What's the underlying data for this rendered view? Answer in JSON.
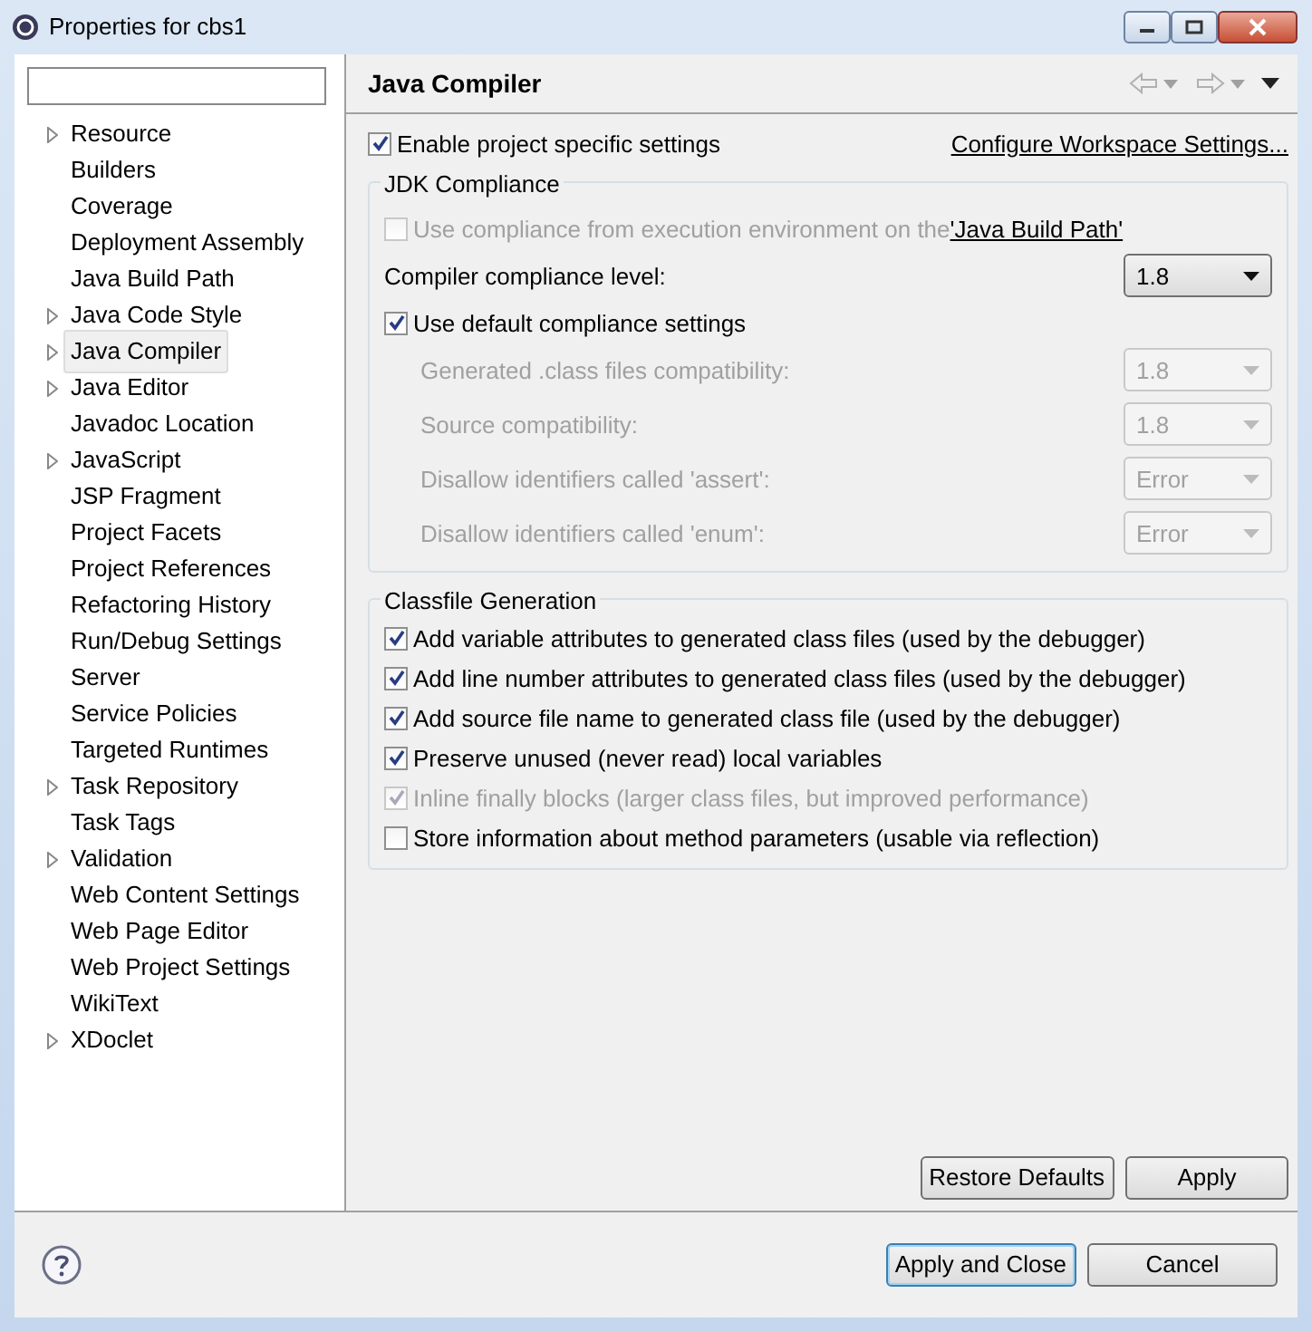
{
  "window": {
    "title": "Properties for cbs1"
  },
  "sidebar": {
    "items": [
      {
        "label": "Resource",
        "expandable": true,
        "selected": false
      },
      {
        "label": "Builders",
        "expandable": false,
        "selected": false
      },
      {
        "label": "Coverage",
        "expandable": false,
        "selected": false
      },
      {
        "label": "Deployment Assembly",
        "expandable": false,
        "selected": false
      },
      {
        "label": "Java Build Path",
        "expandable": false,
        "selected": false
      },
      {
        "label": "Java Code Style",
        "expandable": true,
        "selected": false
      },
      {
        "label": "Java Compiler",
        "expandable": true,
        "selected": true
      },
      {
        "label": "Java Editor",
        "expandable": true,
        "selected": false
      },
      {
        "label": "Javadoc Location",
        "expandable": false,
        "selected": false
      },
      {
        "label": "JavaScript",
        "expandable": true,
        "selected": false
      },
      {
        "label": "JSP Fragment",
        "expandable": false,
        "selected": false
      },
      {
        "label": "Project Facets",
        "expandable": false,
        "selected": false
      },
      {
        "label": "Project References",
        "expandable": false,
        "selected": false
      },
      {
        "label": "Refactoring History",
        "expandable": false,
        "selected": false
      },
      {
        "label": "Run/Debug Settings",
        "expandable": false,
        "selected": false
      },
      {
        "label": "Server",
        "expandable": false,
        "selected": false
      },
      {
        "label": "Service Policies",
        "expandable": false,
        "selected": false
      },
      {
        "label": "Targeted Runtimes",
        "expandable": false,
        "selected": false
      },
      {
        "label": "Task Repository",
        "expandable": true,
        "selected": false
      },
      {
        "label": "Task Tags",
        "expandable": false,
        "selected": false
      },
      {
        "label": "Validation",
        "expandable": true,
        "selected": false
      },
      {
        "label": "Web Content Settings",
        "expandable": false,
        "selected": false
      },
      {
        "label": "Web Page Editor",
        "expandable": false,
        "selected": false
      },
      {
        "label": "Web Project Settings",
        "expandable": false,
        "selected": false
      },
      {
        "label": "WikiText",
        "expandable": false,
        "selected": false
      },
      {
        "label": "XDoclet",
        "expandable": true,
        "selected": false
      }
    ]
  },
  "page": {
    "title": "Java Compiler"
  },
  "project_settings": {
    "label": "Enable project specific settings",
    "checked": true,
    "link": "Configure Workspace Settings..."
  },
  "jdk_compliance": {
    "title": "JDK Compliance",
    "use_environment": {
      "label": "Use compliance from execution environment on the ",
      "link": "'Java Build Path'",
      "checked": false,
      "disabled": true
    },
    "compliance_level": {
      "label": "Compiler compliance level:",
      "value": "1.8",
      "disabled": false
    },
    "use_default": {
      "label": "Use default compliance settings",
      "checked": true
    },
    "settings": [
      {
        "label": "Generated .class files compatibility:",
        "value": "1.8",
        "disabled": true
      },
      {
        "label": "Source compatibility:",
        "value": "1.8",
        "disabled": true
      },
      {
        "label": "Disallow identifiers called 'assert':",
        "value": "Error",
        "disabled": true
      },
      {
        "label": "Disallow identifiers called 'enum':",
        "value": "Error",
        "disabled": true
      }
    ]
  },
  "classfile_generation": {
    "title": "Classfile Generation",
    "options": [
      {
        "label": "Add variable attributes to generated class files (used by the debugger)",
        "checked": true,
        "disabled": false
      },
      {
        "label": "Add line number attributes to generated class files (used by the debugger)",
        "checked": true,
        "disabled": false
      },
      {
        "label": "Add source file name to generated class file (used by the debugger)",
        "checked": true,
        "disabled": false
      },
      {
        "label": "Preserve unused (never read) local variables",
        "checked": true,
        "disabled": false
      },
      {
        "label": "Inline finally blocks (larger class files, but improved performance)",
        "checked": true,
        "disabled": true
      },
      {
        "label": "Store information about method parameters (usable via reflection)",
        "checked": false,
        "disabled": false
      }
    ]
  },
  "page_buttons": [
    {
      "label": "Restore Defaults"
    },
    {
      "label": "Apply"
    }
  ],
  "dialog_buttons": [
    {
      "label": "Apply and Close",
      "default": true
    },
    {
      "label": "Cancel",
      "default": false
    }
  ]
}
